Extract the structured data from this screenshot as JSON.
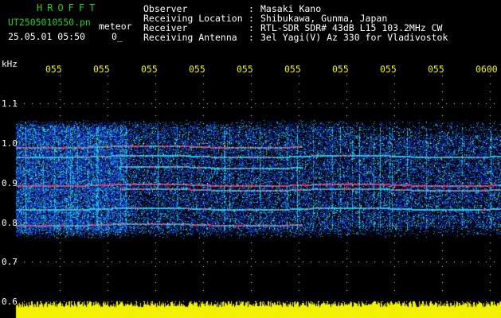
{
  "header": {
    "brand": "HROFFT",
    "filename": "UT2505010550.pn",
    "mode": "meteor",
    "datetime": "25.05.01 05:50",
    "counter": "0_",
    "fields": [
      {
        "label": "Observer",
        "sep": ":",
        "value": "Masaki Kano"
      },
      {
        "label": "Receiving Location",
        "sep": ":",
        "value": "Shibukawa, Gunma, Japan"
      },
      {
        "label": "Receiver",
        "sep": ":",
        "value": "RTL-SDR SDR# 43dB L15 103.2MHz CW"
      },
      {
        "label": "Receiving Antenna",
        "sep": ":",
        "value": "3el Yagi(V) Az 330 for Vladivostok"
      }
    ]
  },
  "spectrogram": {
    "y_unit": "kHz",
    "y_ticks": [
      "1.1",
      "1.0",
      "0.9",
      "0.8",
      "0.7",
      "0.6"
    ],
    "time_ticks": [
      "055",
      "055",
      "055",
      "055",
      "055",
      "055",
      "055",
      "055",
      "055",
      "0600"
    ],
    "colors": {
      "background": "#000000",
      "signal_low": "#1030c8",
      "signal_mid": "#20c8e8",
      "signal_high": "#e83060",
      "level_bar": "#f2f200"
    }
  }
}
